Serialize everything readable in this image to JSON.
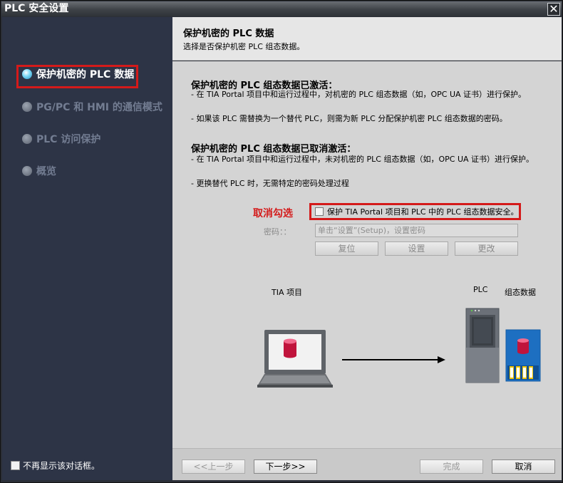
{
  "window": {
    "title": "PLC 安全设置",
    "close_glyph": "✕"
  },
  "sidebar": {
    "items": [
      {
        "label": "保护机密的 PLC 数据",
        "active": true
      },
      {
        "label": "PG/PC 和 HMI 的通信模式",
        "active": false
      },
      {
        "label": "PLC 访问保护",
        "active": false
      },
      {
        "label": "概览",
        "active": false
      }
    ],
    "dont_show_label": "不再显示该对话框。"
  },
  "header": {
    "title": "保护机密的 PLC 数据",
    "subtitle": "选择是否保护机密 PLC 组态数据。"
  },
  "content": {
    "activated": {
      "title": "保护机密的 PLC 组态数据已激活：",
      "line1": "- 在 TIA Portal 项目中和运行过程中，对机密的 PLC 组态数据（如，OPC UA 证书）进行保护。",
      "line2": "- 如果该 PLC 需替换为一个替代 PLC，则需为新 PLC 分配保护机密 PLC 组态数据的密码。"
    },
    "deactivated": {
      "title": "保护机密的 PLC 组态数据已取消激活：",
      "line1": "- 在 TIA Portal 项目中和运行过程中，未对机密的 PLC 组态数据（如，OPC UA 证书）进行保护。",
      "line2": "- 更换替代 PLC 时，无需特定的密码处理过程"
    },
    "annotation": "取消勾选",
    "protect_checkbox_label": "保护 TIA Portal 项目和 PLC 中的 PLC 组态数据安全。",
    "protect_checked": false,
    "password_label": "密码：：",
    "password_placeholder": "单击“设置”(Setup)，设置密码",
    "buttons": {
      "reset": "复位",
      "set": "设置",
      "change": "更改"
    },
    "diagram": {
      "tia_label": "TIA 项目",
      "plc_label": "PLC",
      "config_label": "组态数据"
    }
  },
  "footer": {
    "prev": "<<上一步",
    "next": "下一步>>",
    "finish": "完成",
    "cancel": "取消"
  },
  "colors": {
    "accent_red": "#d41a1a",
    "sidebar_bg": "#2d3446",
    "active_dot": "#4fc1ea"
  }
}
